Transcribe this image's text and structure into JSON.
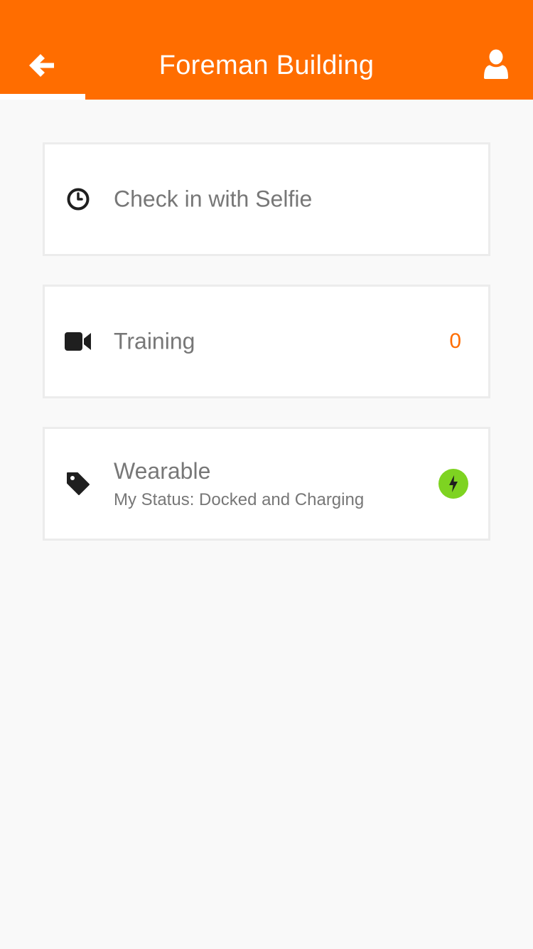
{
  "header": {
    "title": "Foreman Building",
    "back_icon": "arrow-left-icon",
    "profile_icon": "user-icon",
    "background_color": "#ff6d00"
  },
  "cards": [
    {
      "label": "Check in with Selfie",
      "icon": "clock-icon"
    },
    {
      "label": "Training",
      "icon": "video-camera-icon",
      "count": "0"
    },
    {
      "label": "Wearable",
      "icon": "tag-icon",
      "status": "My Status: Docked and Charging",
      "status_icon": "charging-bolt-icon",
      "status_color": "#7ed321"
    }
  ]
}
